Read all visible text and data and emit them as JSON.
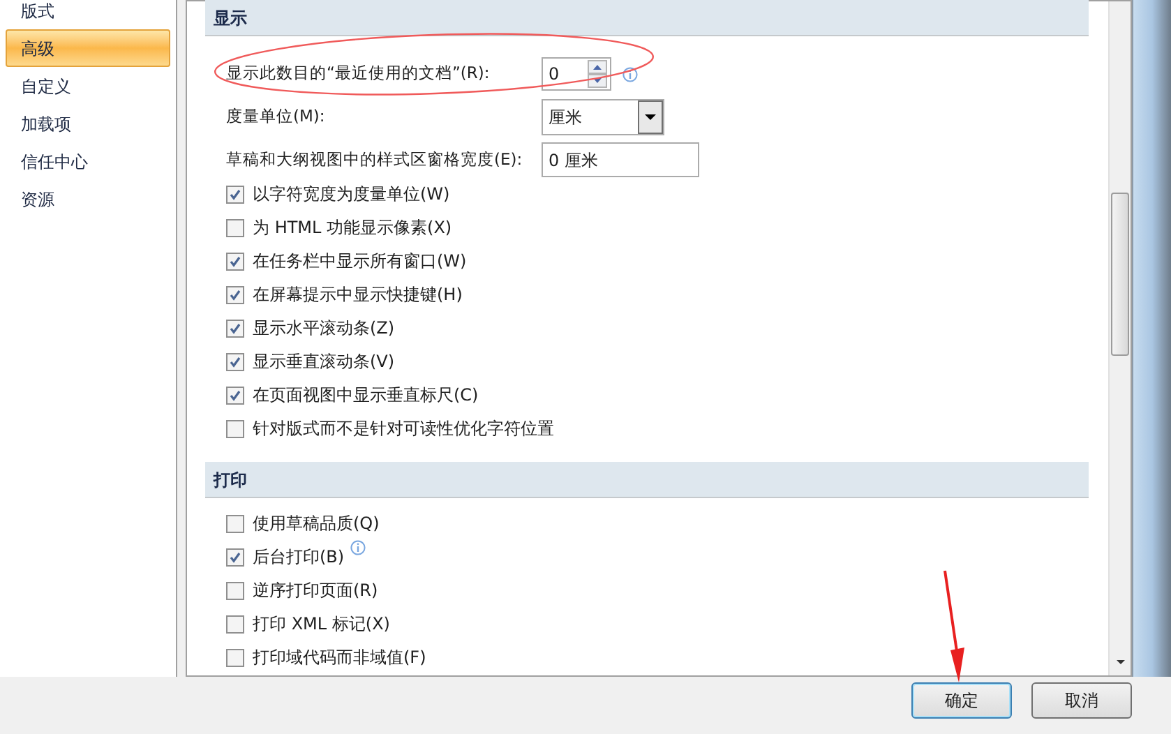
{
  "sidebar": {
    "items": [
      {
        "label": "版式",
        "selected": false
      },
      {
        "label": "高级",
        "selected": true
      },
      {
        "label": "自定义",
        "selected": false
      },
      {
        "label": "加载项",
        "selected": false
      },
      {
        "label": "信任中心",
        "selected": false
      },
      {
        "label": "资源",
        "selected": false
      }
    ]
  },
  "sections": [
    {
      "title": "显示",
      "items": [
        {
          "kind": "spin",
          "label": "显示此数目的“最近使用的文档”(R):",
          "value": "0",
          "info": true
        },
        {
          "kind": "dropdown",
          "label": "度量单位(M):",
          "value": "厘米"
        },
        {
          "kind": "text",
          "label": "草稿和大纲视图中的样式区窗格宽度(E):",
          "value": "0 厘米"
        },
        {
          "kind": "checkbox",
          "label": "以字符宽度为度量单位(W)",
          "checked": true
        },
        {
          "kind": "checkbox",
          "label": "为 HTML 功能显示像素(X)",
          "checked": false
        },
        {
          "kind": "checkbox",
          "label": "在任务栏中显示所有窗口(W)",
          "checked": true
        },
        {
          "kind": "checkbox",
          "label": "在屏幕提示中显示快捷键(H)",
          "checked": true
        },
        {
          "kind": "checkbox",
          "label": "显示水平滚动条(Z)",
          "checked": true
        },
        {
          "kind": "checkbox",
          "label": "显示垂直滚动条(V)",
          "checked": true
        },
        {
          "kind": "checkbox",
          "label": "在页面视图中显示垂直标尺(C)",
          "checked": true
        },
        {
          "kind": "checkbox",
          "label": "针对版式而不是针对可读性优化字符位置",
          "checked": false
        }
      ]
    },
    {
      "title": "打印",
      "items": [
        {
          "kind": "checkbox",
          "label": "使用草稿品质(Q)",
          "checked": false
        },
        {
          "kind": "checkbox",
          "label": "后台打印(B)",
          "checked": true,
          "info": true
        },
        {
          "kind": "checkbox",
          "label": "逆序打印页面(R)",
          "checked": false
        },
        {
          "kind": "checkbox",
          "label": "打印 XML 标记(X)",
          "checked": false
        },
        {
          "kind": "checkbox",
          "label": "打印域代码而非域值(F)",
          "checked": false
        }
      ]
    }
  ],
  "buttons": [
    {
      "label": "确定",
      "default": true
    },
    {
      "label": "取消",
      "default": false
    }
  ]
}
